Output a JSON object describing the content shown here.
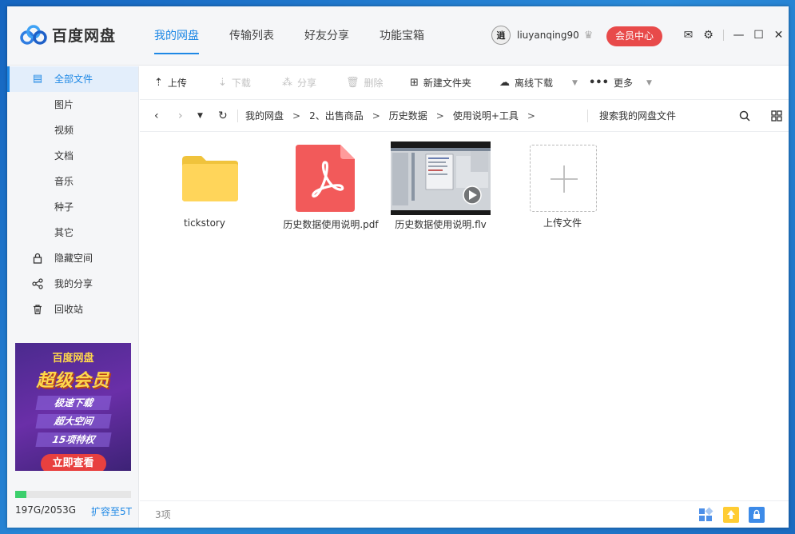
{
  "app": {
    "name": "百度网盘"
  },
  "nav": {
    "items": [
      "我的网盘",
      "传输列表",
      "好友分享",
      "功能宝箱"
    ],
    "active": 0
  },
  "user": {
    "avatar_text": "逍",
    "name": "liuyanqing90",
    "vip_button": "会员中心"
  },
  "colors": {
    "accent": "#1e88e5",
    "vip": "#e84a4a",
    "storage": "#3ccf6c",
    "pdf": "#f25a5a",
    "folder": "#ffd55a"
  },
  "sidebar": {
    "items": [
      {
        "label": "全部文件",
        "icon": "file-icon",
        "active": true
      },
      {
        "label": "图片"
      },
      {
        "label": "视频"
      },
      {
        "label": "文档"
      },
      {
        "label": "音乐"
      },
      {
        "label": "种子"
      },
      {
        "label": "其它"
      },
      {
        "label": "隐藏空间",
        "icon": "lock-icon"
      },
      {
        "label": "我的分享",
        "icon": "share-icon"
      },
      {
        "label": "回收站",
        "icon": "trash-icon"
      }
    ],
    "promo": {
      "brand": "百度网盘",
      "headline": "超级会员",
      "perks": [
        "极速下载",
        "超大空间",
        "15项特权"
      ],
      "button": "立即查看"
    },
    "storage": {
      "text": "197G/2053G",
      "used_fraction": 0.096,
      "expand_label": "扩容至5T"
    }
  },
  "toolbar": {
    "upload": "上传",
    "download": "下载",
    "share": "分享",
    "delete": "删除",
    "new_folder": "新建文件夹",
    "offline_download": "离线下载",
    "more": "更多"
  },
  "address": {
    "crumbs": [
      "我的网盘",
      "2、出售商品",
      "历史数据",
      "使用说明+工具"
    ],
    "search_placeholder": "搜索我的网盘文件"
  },
  "files": [
    {
      "name": "tickstory",
      "type": "folder"
    },
    {
      "name": "历史数据使用说明.pdf",
      "type": "pdf"
    },
    {
      "name": "历史数据使用说明.flv",
      "type": "video"
    },
    {
      "name": "上传文件",
      "type": "upload"
    }
  ],
  "status": {
    "count": "3项"
  }
}
